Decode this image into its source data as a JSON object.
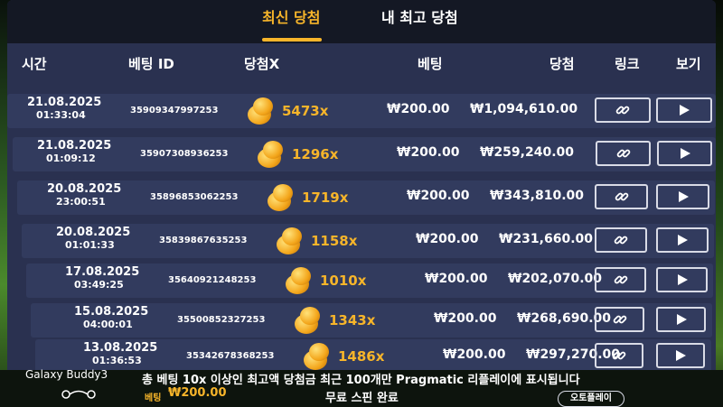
{
  "tabs": {
    "recent": "최신 당첨",
    "mine": "내 최고 당첨"
  },
  "columns": {
    "time": "시간",
    "bet_id": "베팅 ID",
    "multiplier": "당첨X",
    "bet": "베팅",
    "win": "당첨",
    "link": "링크",
    "view": "보기"
  },
  "rows": [
    {
      "date": "21.08.2025",
      "time": "01:33:04",
      "bet_id": "35909347997253",
      "multiplier": "5473x",
      "bet": "₩200.00",
      "win": "₩1,094,610.00"
    },
    {
      "date": "21.08.2025",
      "time": "01:09:12",
      "bet_id": "35907308936253",
      "multiplier": "1296x",
      "bet": "₩200.00",
      "win": "₩259,240.00"
    },
    {
      "date": "20.08.2025",
      "time": "23:00:51",
      "bet_id": "35896853062253",
      "multiplier": "1719x",
      "bet": "₩200.00",
      "win": "₩343,810.00"
    },
    {
      "date": "20.08.2025",
      "time": "01:01:33",
      "bet_id": "35839867635253",
      "multiplier": "1158x",
      "bet": "₩200.00",
      "win": "₩231,660.00"
    },
    {
      "date": "17.08.2025",
      "time": "03:49:25",
      "bet_id": "35640921248253",
      "multiplier": "1010x",
      "bet": "₩200.00",
      "win": "₩202,070.00"
    },
    {
      "date": "15.08.2025",
      "time": "04:00:01",
      "bet_id": "35500852327253",
      "multiplier": "1343x",
      "bet": "₩200.00",
      "win": "₩268,690.00"
    },
    {
      "date": "13.08.2025",
      "time": "01:36:53",
      "bet_id": "35342678368253",
      "multiplier": "1486x",
      "bet": "₩200.00",
      "win": "₩297,270.00"
    }
  ],
  "footer": {
    "note": "총 베팅 10x 이상인 최고액 당첨금 최근 100개만 Pragmatic 리플레이에 표시됩니다",
    "status": "무료 스핀 완료",
    "bet_label": "베팅",
    "bet_value": "₩200.00",
    "autoplay": "오토플레이"
  },
  "watermark": "Galaxy Buddy3",
  "icons": {
    "link": "link-icon",
    "view": "play-icon",
    "coin": "coin-stack-icon"
  },
  "colors": {
    "accent": "#f7b52a",
    "panel": "#2a3150",
    "row": "#323b5e",
    "tabbar": "#141824"
  }
}
